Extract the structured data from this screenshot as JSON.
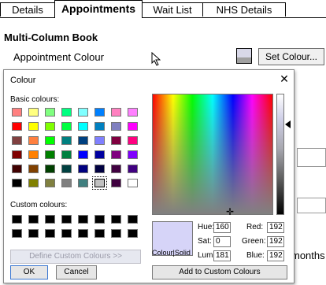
{
  "tabs": [
    {
      "label": "Details",
      "active": false
    },
    {
      "label": "Appointments",
      "active": true
    },
    {
      "label": "Wait List",
      "active": false
    },
    {
      "label": "NHS Details",
      "active": false
    }
  ],
  "form": {
    "section_title": "Multi-Column Book",
    "appointment_colour_label": "Appointment Colour",
    "set_colour_button": "Set Colour...",
    "months_text": "months"
  },
  "dialog": {
    "title": "Colour",
    "close_glyph": "✕",
    "basic_colours_label": "Basic colours:",
    "custom_colours_label": "Custom colours:",
    "define_custom_button": "Define Custom Colours >>",
    "ok_button": "OK",
    "cancel_button": "Cancel",
    "add_custom_button": "Add to Custom Colours",
    "preview_label": "Colour|Solid",
    "basic_colours": [
      "#ff8080",
      "#ffff80",
      "#80ff80",
      "#00ff80",
      "#80ffff",
      "#0080ff",
      "#ff80c0",
      "#ff80ff",
      "#ff0000",
      "#ffff00",
      "#80ff00",
      "#00ff40",
      "#00ffff",
      "#0080c0",
      "#8080c0",
      "#ff00ff",
      "#804040",
      "#ff8040",
      "#00ff00",
      "#008080",
      "#004080",
      "#8080ff",
      "#800040",
      "#ff0080",
      "#800000",
      "#ff8000",
      "#008000",
      "#008040",
      "#0000ff",
      "#0000a0",
      "#800080",
      "#8000ff",
      "#400000",
      "#804000",
      "#004000",
      "#004040",
      "#000080",
      "#000040",
      "#400040",
      "#400080",
      "#000000",
      "#808000",
      "#808040",
      "#808080",
      "#408080",
      "#c0c0c0",
      "#400040",
      "#ffffff"
    ],
    "selected_basic_index": 45,
    "hue_label": "Hue:",
    "sat_label": "Sat:",
    "lum_label": "Lum:",
    "red_label": "Red:",
    "green_label": "Green:",
    "blue_label": "Blue:",
    "hue": "160",
    "sat": "0",
    "lum": "181",
    "red": "192",
    "green": "192",
    "blue": "192"
  },
  "colors": {
    "preview": "#d6d4f8"
  }
}
